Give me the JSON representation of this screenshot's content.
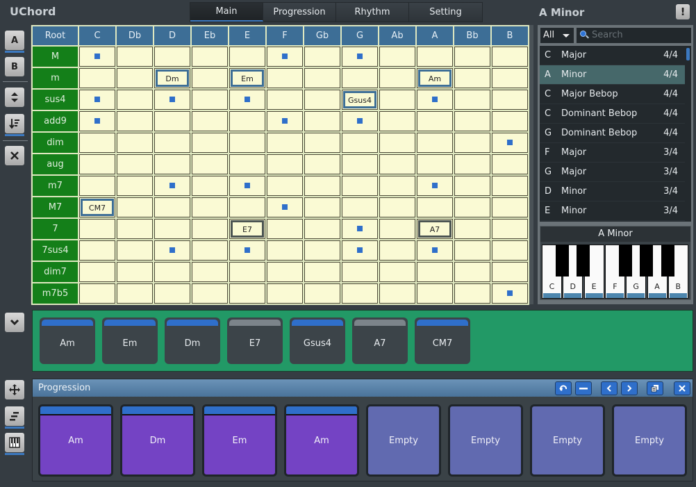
{
  "app": {
    "title": "UChord",
    "current_key": "A Minor",
    "alert_label": "!"
  },
  "tabs": [
    {
      "label": "Main",
      "active": true
    },
    {
      "label": "Progression",
      "active": false
    },
    {
      "label": "Rhythm",
      "active": false
    },
    {
      "label": "Setting",
      "active": false
    }
  ],
  "leftbar": {
    "a_label": "A",
    "b_label": "B",
    "icons": [
      "sort-updown-icon",
      "sort-list-icon",
      "close-icon",
      "collapse-chevron-icon",
      "move-icon",
      "align-icon",
      "piano-icon"
    ]
  },
  "grid": {
    "root_header": "Root",
    "columns": [
      "C",
      "Db",
      "D",
      "Eb",
      "E",
      "F",
      "Gb",
      "G",
      "Ab",
      "A",
      "Bb",
      "B"
    ],
    "rows": [
      {
        "label": "M",
        "cells": [
          "dot",
          "",
          "",
          "",
          "",
          "dot",
          "",
          "dot",
          "",
          "",
          "",
          ""
        ]
      },
      {
        "label": "m",
        "cells": [
          "",
          "",
          "Dm",
          "",
          "Em",
          "",
          "",
          "",
          "",
          "Am",
          "",
          ""
        ]
      },
      {
        "label": "sus4",
        "cells": [
          "dot",
          "",
          "dot",
          "",
          "dot",
          "",
          "",
          "Gsus4",
          "",
          "dot",
          "",
          ""
        ]
      },
      {
        "label": "add9",
        "cells": [
          "dot",
          "",
          "",
          "",
          "",
          "dot",
          "",
          "dot",
          "",
          "",
          "",
          ""
        ]
      },
      {
        "label": "dim",
        "cells": [
          "",
          "",
          "",
          "",
          "",
          "",
          "",
          "",
          "",
          "",
          "",
          "dot"
        ]
      },
      {
        "label": "aug",
        "cells": [
          "",
          "",
          "",
          "",
          "",
          "",
          "",
          "",
          "",
          "",
          "",
          ""
        ]
      },
      {
        "label": "m7",
        "cells": [
          "",
          "",
          "dot",
          "",
          "dot",
          "",
          "",
          "",
          "",
          "dot",
          "",
          ""
        ]
      },
      {
        "label": "M7",
        "cells": [
          "CM7",
          "",
          "",
          "",
          "",
          "dot",
          "",
          "",
          "",
          "",
          "",
          ""
        ]
      },
      {
        "label": "7",
        "cells": [
          "",
          "",
          "",
          "",
          "E7",
          "",
          "",
          "dot",
          "",
          "A7",
          "",
          ""
        ]
      },
      {
        "label": "7sus4",
        "cells": [
          "",
          "",
          "dot",
          "",
          "dot",
          "",
          "",
          "dot",
          "",
          "dot",
          "",
          ""
        ]
      },
      {
        "label": "dim7",
        "cells": [
          "",
          "",
          "",
          "",
          "",
          "",
          "",
          "",
          "",
          "",
          "",
          ""
        ]
      },
      {
        "label": "m7b5",
        "cells": [
          "",
          "",
          "",
          "",
          "",
          "",
          "",
          "",
          "",
          "",
          "",
          "dot"
        ]
      }
    ],
    "dark_selected": [
      "E7",
      "A7"
    ]
  },
  "scales": {
    "filter_value": "All",
    "search_placeholder": "Search",
    "items": [
      {
        "root": "C",
        "name": "Major",
        "meter": "4/4",
        "selected": false
      },
      {
        "root": "A",
        "name": "Minor",
        "meter": "4/4",
        "selected": true
      },
      {
        "root": "C",
        "name": "Major Bebop",
        "meter": "4/4",
        "selected": false
      },
      {
        "root": "C",
        "name": "Dominant Bebop",
        "meter": "4/4",
        "selected": false
      },
      {
        "root": "G",
        "name": "Dominant Bebop",
        "meter": "4/4",
        "selected": false
      },
      {
        "root": "F",
        "name": "Major",
        "meter": "3/4",
        "selected": false
      },
      {
        "root": "G",
        "name": "Major",
        "meter": "3/4",
        "selected": false
      },
      {
        "root": "D",
        "name": "Minor",
        "meter": "3/4",
        "selected": false
      },
      {
        "root": "E",
        "name": "Minor",
        "meter": "3/4",
        "selected": false
      }
    ]
  },
  "piano": {
    "title": "A Minor",
    "white_keys": [
      "C",
      "D",
      "E",
      "F",
      "G",
      "A",
      "B"
    ]
  },
  "palette": {
    "cards": [
      {
        "label": "Am",
        "strip": "blue"
      },
      {
        "label": "Em",
        "strip": "blue"
      },
      {
        "label": "Dm",
        "strip": "blue"
      },
      {
        "label": "E7",
        "strip": "gray"
      },
      {
        "label": "Gsus4",
        "strip": "blue"
      },
      {
        "label": "A7",
        "strip": "gray"
      },
      {
        "label": "CM7",
        "strip": "blue"
      }
    ]
  },
  "progression": {
    "title": "Progression",
    "buttons": [
      "undo-icon",
      "minus-icon",
      "prev-icon",
      "next-icon",
      "copy-icon",
      "close-icon"
    ],
    "slots": [
      {
        "label": "Am",
        "filled": true
      },
      {
        "label": "Dm",
        "filled": true
      },
      {
        "label": "Em",
        "filled": true
      },
      {
        "label": "Am",
        "filled": true
      },
      {
        "label": "Empty",
        "filled": false
      },
      {
        "label": "Empty",
        "filled": false
      },
      {
        "label": "Empty",
        "filled": false
      },
      {
        "label": "Empty",
        "filled": false
      }
    ]
  },
  "colors": {
    "accent_blue": "#2f6fca",
    "row_header_green": "#147f19",
    "palette_green": "#229966",
    "filled_slot_purple": "#7443c4",
    "empty_slot_indigo": "#616ab0",
    "cell_bg": "#fafad4"
  }
}
